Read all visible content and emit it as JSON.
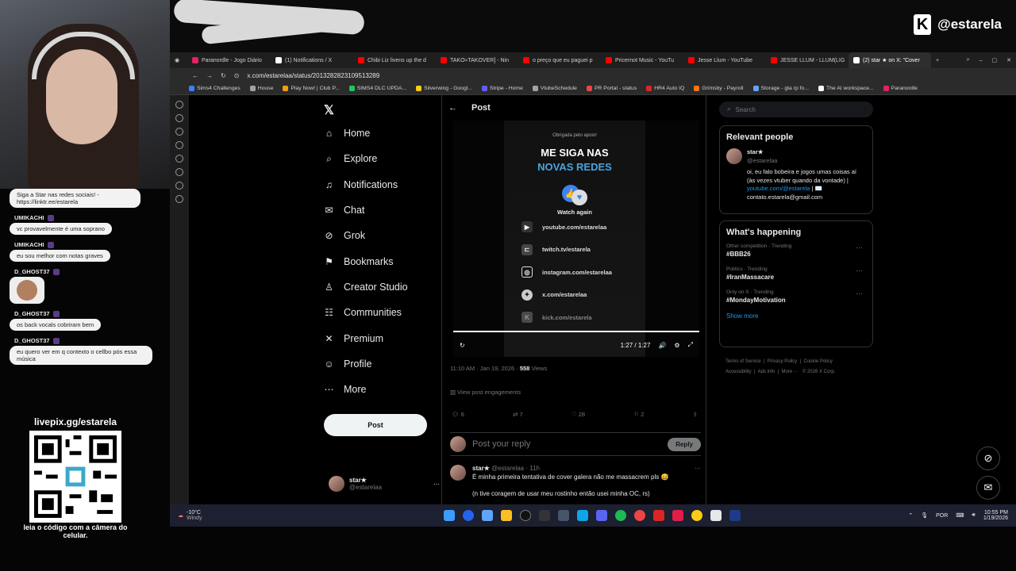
{
  "stream": {
    "handle": "@estarela",
    "qr_title": "livepix.gg/estarela",
    "qr_caption": "leia o código com a câmera do celular."
  },
  "chat": [
    {
      "user": "",
      "text": "Siga a Star nas redes sociais! - https://linktr.ee/estarela"
    },
    {
      "user": "UMIKACHI",
      "text": "vc provavelmente é uma soprano"
    },
    {
      "user": "UMIKACHI",
      "text": "eu sou melhor com notas graves"
    },
    {
      "user": "D_GHOST37",
      "text": ""
    },
    {
      "user": "D_GHOST37",
      "text": "os back vocals cobriram bem"
    },
    {
      "user": "D_GHOST37",
      "text": "eu quero ver em q contexto o cellbo pós essa música"
    }
  ],
  "browser": {
    "tabs": [
      {
        "label": "Paranordle - Jogo Diário",
        "color": "#e0245e"
      },
      {
        "label": "(1) Notifications / X",
        "color": "#ffffff"
      },
      {
        "label": "Chibi Liz livens up the d",
        "color": "#ff0000"
      },
      {
        "label": "TAKO≈TAKOVER] - Nin",
        "color": "#ff0000"
      },
      {
        "label": "o preço que eu paguei p",
        "color": "#ff0000"
      },
      {
        "label": "Pricernot Music - YouTu",
        "color": "#ff0000"
      },
      {
        "label": "Jesse Llum - YouTube",
        "color": "#ff0000"
      },
      {
        "label": "JESSE LLUM - LLUM(LIG",
        "color": "#ff0000"
      },
      {
        "label": "(2) star ★ on X: \"Cover",
        "color": "#ffffff"
      }
    ],
    "url": "x.com/estarelaa/status/2013282823109513289",
    "bookmarks": [
      {
        "label": "Sims4 Challenges",
        "color": "#3b82f6"
      },
      {
        "label": "House",
        "color": "#a3a3a3"
      },
      {
        "label": "Play Now! | Club P...",
        "color": "#f59e0b"
      },
      {
        "label": "SIMS4 DLC UPDA...",
        "color": "#22c55e"
      },
      {
        "label": "Silverwing - Googl...",
        "color": "#facc15"
      },
      {
        "label": "Stripe - Home",
        "color": "#635bff"
      },
      {
        "label": "VtubeSchedule",
        "color": "#a3a3a3"
      },
      {
        "label": "PR Portal - status",
        "color": "#ef4444"
      },
      {
        "label": "HR4 Auto IQ",
        "color": "#dc2626"
      },
      {
        "label": "Grimsby - Payroll",
        "color": "#f97316"
      },
      {
        "label": "Storage - gta rp fo...",
        "color": "#60a5fa"
      },
      {
        "label": "The AI workspace...",
        "color": "#ffffff"
      },
      {
        "label": "Paranordle",
        "color": "#e0245e"
      }
    ]
  },
  "x": {
    "nav": [
      {
        "label": "Home",
        "icon": "home-icon",
        "glyph": "⌂"
      },
      {
        "label": "Explore",
        "icon": "search-icon",
        "glyph": "⌕"
      },
      {
        "label": "Notifications",
        "icon": "bell-icon",
        "glyph": "🔔"
      },
      {
        "label": "Chat",
        "icon": "mail-icon",
        "glyph": "✉"
      },
      {
        "label": "Grok",
        "icon": "grok-icon",
        "glyph": "⊘"
      },
      {
        "label": "Bookmarks",
        "icon": "bookmark-icon",
        "glyph": "⚑"
      },
      {
        "label": "Creator Studio",
        "icon": "creator-icon",
        "glyph": "♙"
      },
      {
        "label": "Communities",
        "icon": "communities-icon",
        "glyph": "☷"
      },
      {
        "label": "Premium",
        "icon": "x-logo-icon",
        "glyph": "✕"
      },
      {
        "label": "Profile",
        "icon": "profile-icon",
        "glyph": "☺"
      },
      {
        "label": "More",
        "icon": "more-icon",
        "glyph": "⋯"
      }
    ],
    "post_button": "Post",
    "account": {
      "name": "star★",
      "handle": "@estarelaa"
    },
    "post_header": "Post",
    "video": {
      "small_text": "Obrigada pelo apoio!",
      "title_line1": "ME SIGA NAS",
      "title_line2": "NOVAS REDES",
      "watch_again": "Watch again",
      "links": [
        {
          "icon": "youtube-icon",
          "text": "youtube.com/estarelaa"
        },
        {
          "icon": "twitch-icon",
          "text": "twitch.tv/estarela"
        },
        {
          "icon": "instagram-icon",
          "text": "instagram.com/estarelaa"
        },
        {
          "icon": "twitter-icon",
          "text": "x.com/estarelaa"
        },
        {
          "icon": "kick-icon",
          "text": "kick.com/estarela"
        }
      ],
      "time": "1:27 / 1:27"
    },
    "meta_time": "11:10 AM · Jan 19, 2026 · ",
    "views_count": "558",
    "views_label": " Views",
    "engagements": "View post engagements",
    "counts": {
      "replies": "6",
      "reposts": "7",
      "likes": "28",
      "bookmarks": "2"
    },
    "reply_placeholder": "Post your reply",
    "reply_button": "Reply",
    "reply_tweet": {
      "name": "star★",
      "handle": "@estarelaa · 11h",
      "text1": "É minha primeira tentativa de cover galera não me massacrem pls 😅",
      "text2": "(n tive coragem de usar meu rostinho então usei minha OC, rs)"
    },
    "search_placeholder": "Search",
    "relevant": {
      "heading": "Relevant people",
      "name": "star★",
      "handle": "@estarelaa",
      "bio1": "oi, eu falo bobeira e jogos umas coisas aí (às vezes vtuber quando da vontade) | ",
      "bio_link": "youtube.com/@estarela",
      "bio2": " | ✉️ contato.estarela@gmail.com"
    },
    "happening": {
      "heading": "What's happening",
      "trends": [
        {
          "context": "Other competition · Trending",
          "name": "#BBB26"
        },
        {
          "context": "Politics · Trending",
          "name": "#IranMassacare"
        },
        {
          "context": "Only on X · Trending",
          "name": "#MondayMotivation"
        }
      ],
      "show_more": "Show more"
    },
    "footer": [
      "Terms of Service",
      "Privacy Policy",
      "Cookie Policy",
      "Accessibility",
      "Ads info",
      "More ···",
      "© 2026 X Corp."
    ]
  },
  "taskbar": {
    "weather_temp": "-10°C",
    "weather_desc": "Windy",
    "lang": "POR",
    "time": "10:55 PM",
    "date": "1/19/2026"
  },
  "colors": {
    "accent": "#1d9bf0",
    "background": "#000000",
    "text": "#e7e9ea",
    "muted": "#71767b"
  }
}
